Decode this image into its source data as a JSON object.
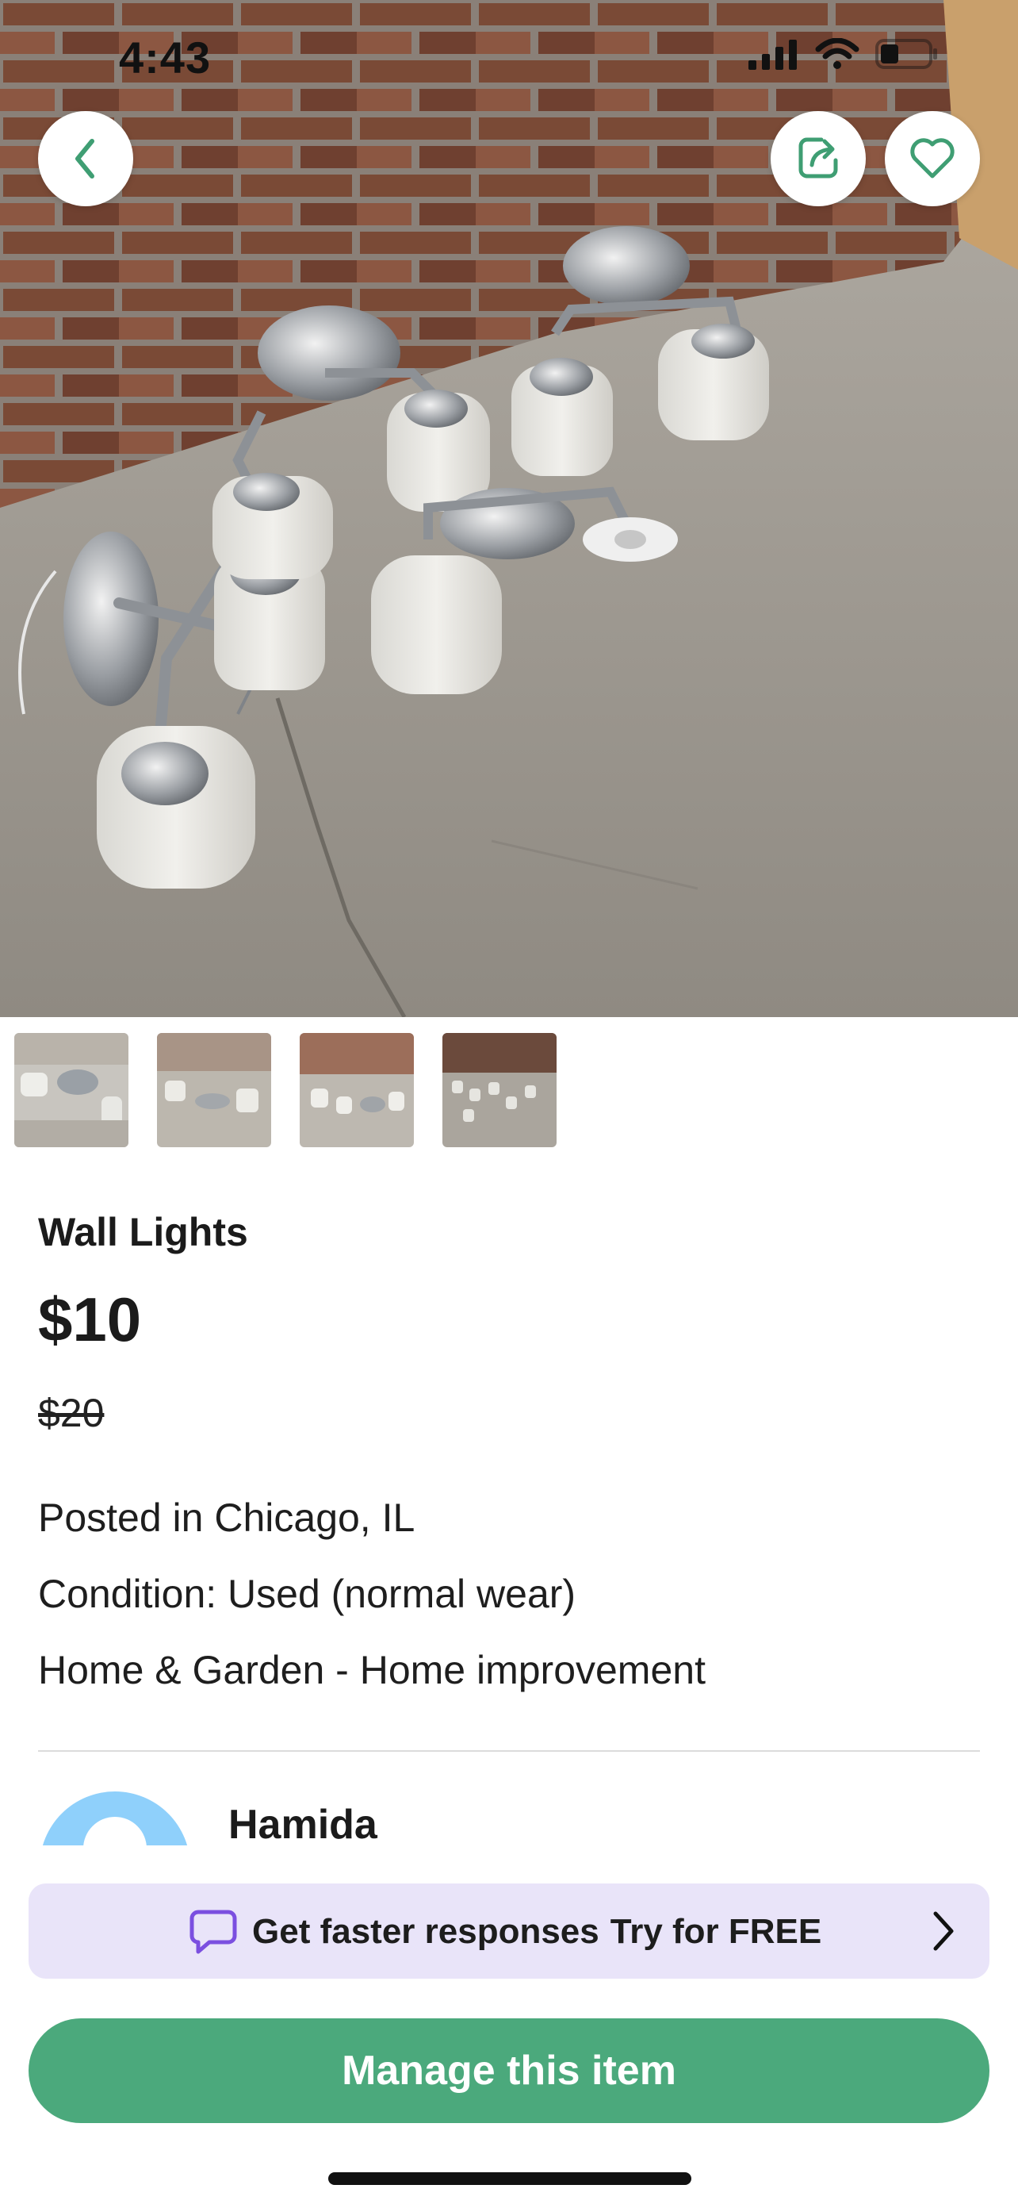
{
  "status_bar": {
    "time": "4:43",
    "icons": [
      "cellular-signal-icon",
      "wifi-icon",
      "battery-icon"
    ]
  },
  "top_actions": {
    "back": "chevron-left-icon",
    "share": "share-icon",
    "favorite": "heart-icon"
  },
  "gallery": {
    "thumbnail_count": 4
  },
  "listing": {
    "title": "Wall Lights",
    "price": "$10",
    "original_price": "$20",
    "location": "Posted in Chicago, IL",
    "condition": "Condition: Used (normal wear)",
    "category": "Home & Garden - Home improvement"
  },
  "seller": {
    "name": "Hamida"
  },
  "promo": {
    "text": "Get faster responses",
    "cta": "Try for FREE"
  },
  "primary_action": {
    "label": "Manage this item"
  },
  "colors": {
    "accent_green": "#4ba97c",
    "promo_background": "#e9e4f9",
    "promo_icon": "#7b4fe0",
    "avatar": "#8fd0fb"
  }
}
